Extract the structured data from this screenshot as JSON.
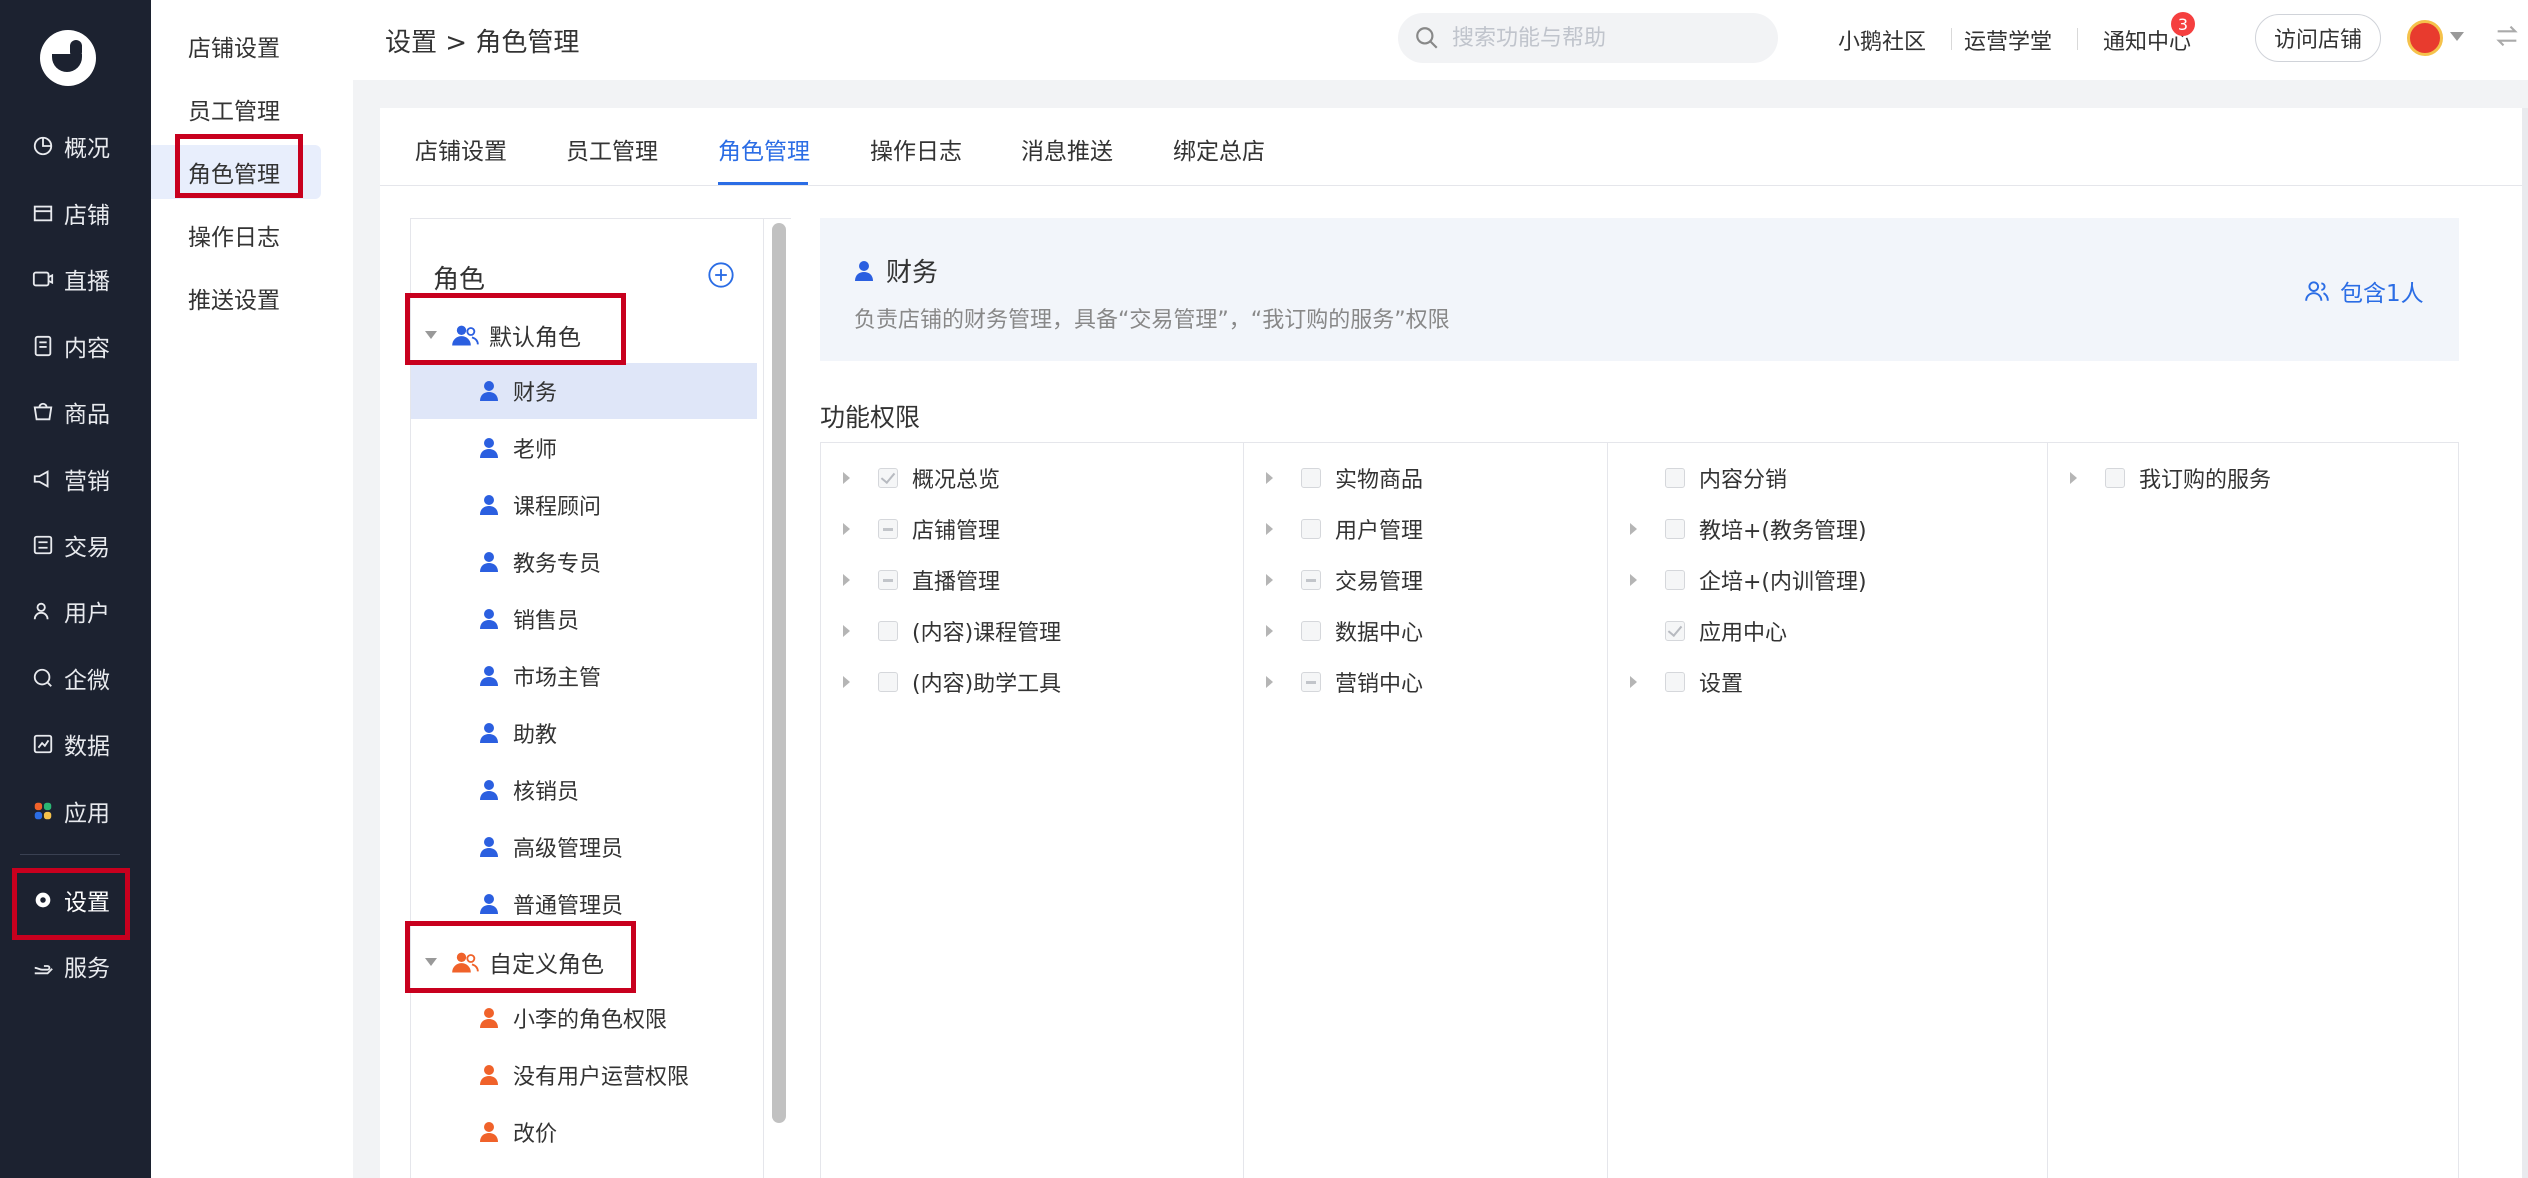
{
  "nav": {
    "items": [
      {
        "label": "概况",
        "icon": "pie-chart-icon"
      },
      {
        "label": "店铺",
        "icon": "store-icon"
      },
      {
        "label": "直播",
        "icon": "live-icon"
      },
      {
        "label": "内容",
        "icon": "content-icon"
      },
      {
        "label": "商品",
        "icon": "goods-icon"
      },
      {
        "label": "营销",
        "icon": "megaphone-icon"
      },
      {
        "label": "交易",
        "icon": "trade-icon"
      },
      {
        "label": "用户",
        "icon": "user-icon"
      },
      {
        "label": "企微",
        "icon": "wecom-icon"
      },
      {
        "label": "数据",
        "icon": "data-icon"
      },
      {
        "label": "应用",
        "icon": "apps-icon"
      },
      {
        "label": "设置",
        "icon": "gear-icon"
      },
      {
        "label": "服务",
        "icon": "service-icon"
      }
    ]
  },
  "subnav": {
    "items": [
      "店铺设置",
      "员工管理",
      "角色管理",
      "操作日志",
      "推送设置"
    ]
  },
  "header": {
    "breadcrumb": "设置 > 角色管理",
    "search_placeholder": "搜索功能与帮助",
    "links": [
      "小鹅社区",
      "运营学堂",
      "通知中心"
    ],
    "notification_count": "3",
    "visit_store": "访问店铺"
  },
  "tabs": [
    "店铺设置",
    "员工管理",
    "角色管理",
    "操作日志",
    "消息推送",
    "绑定总店"
  ],
  "roles_panel": {
    "title": "角色",
    "default_group": "默认角色",
    "default_roles": [
      "财务",
      "老师",
      "课程顾问",
      "教务专员",
      "销售员",
      "市场主管",
      "助教",
      "核销员",
      "高级管理员",
      "普通管理员"
    ],
    "custom_group": "自定义角色",
    "custom_roles": [
      "小李的角色权限",
      "没有用户运营权限",
      "改价"
    ]
  },
  "role_detail": {
    "name": "财务",
    "description": "负责店铺的财务管理，具备“交易管理”，“我订购的服务”权限",
    "member_count": "包含1人"
  },
  "permissions": {
    "title": "功能权限",
    "columns": [
      [
        {
          "label": "概况总览",
          "state": "checked",
          "expand": true
        },
        {
          "label": "店铺管理",
          "state": "partial",
          "expand": true
        },
        {
          "label": "直播管理",
          "state": "partial",
          "expand": true
        },
        {
          "label": "(内容)课程管理",
          "state": "none",
          "expand": true
        },
        {
          "label": "(内容)助学工具",
          "state": "none",
          "expand": true
        }
      ],
      [
        {
          "label": "实物商品",
          "state": "none",
          "expand": true
        },
        {
          "label": "用户管理",
          "state": "none",
          "expand": true
        },
        {
          "label": "交易管理",
          "state": "partial",
          "expand": true
        },
        {
          "label": "数据中心",
          "state": "none",
          "expand": true
        },
        {
          "label": "营销中心",
          "state": "partial",
          "expand": true
        }
      ],
      [
        {
          "label": "内容分销",
          "state": "none",
          "expand": false
        },
        {
          "label": "教培+(教务管理)",
          "state": "none",
          "expand": true
        },
        {
          "label": "企培+(内训管理)",
          "state": "none",
          "expand": true
        },
        {
          "label": "应用中心",
          "state": "checked",
          "expand": false
        },
        {
          "label": "设置",
          "state": "none",
          "expand": true
        }
      ],
      [
        {
          "label": "我订购的服务",
          "state": "none",
          "expand": true
        }
      ]
    ]
  },
  "colors": {
    "nav_bg": "#1c2230",
    "accent": "#2b6de5",
    "default_role_icon": "#2b5fe0",
    "custom_role_icon": "#f0622a",
    "highlight_box": "#c8001e"
  }
}
